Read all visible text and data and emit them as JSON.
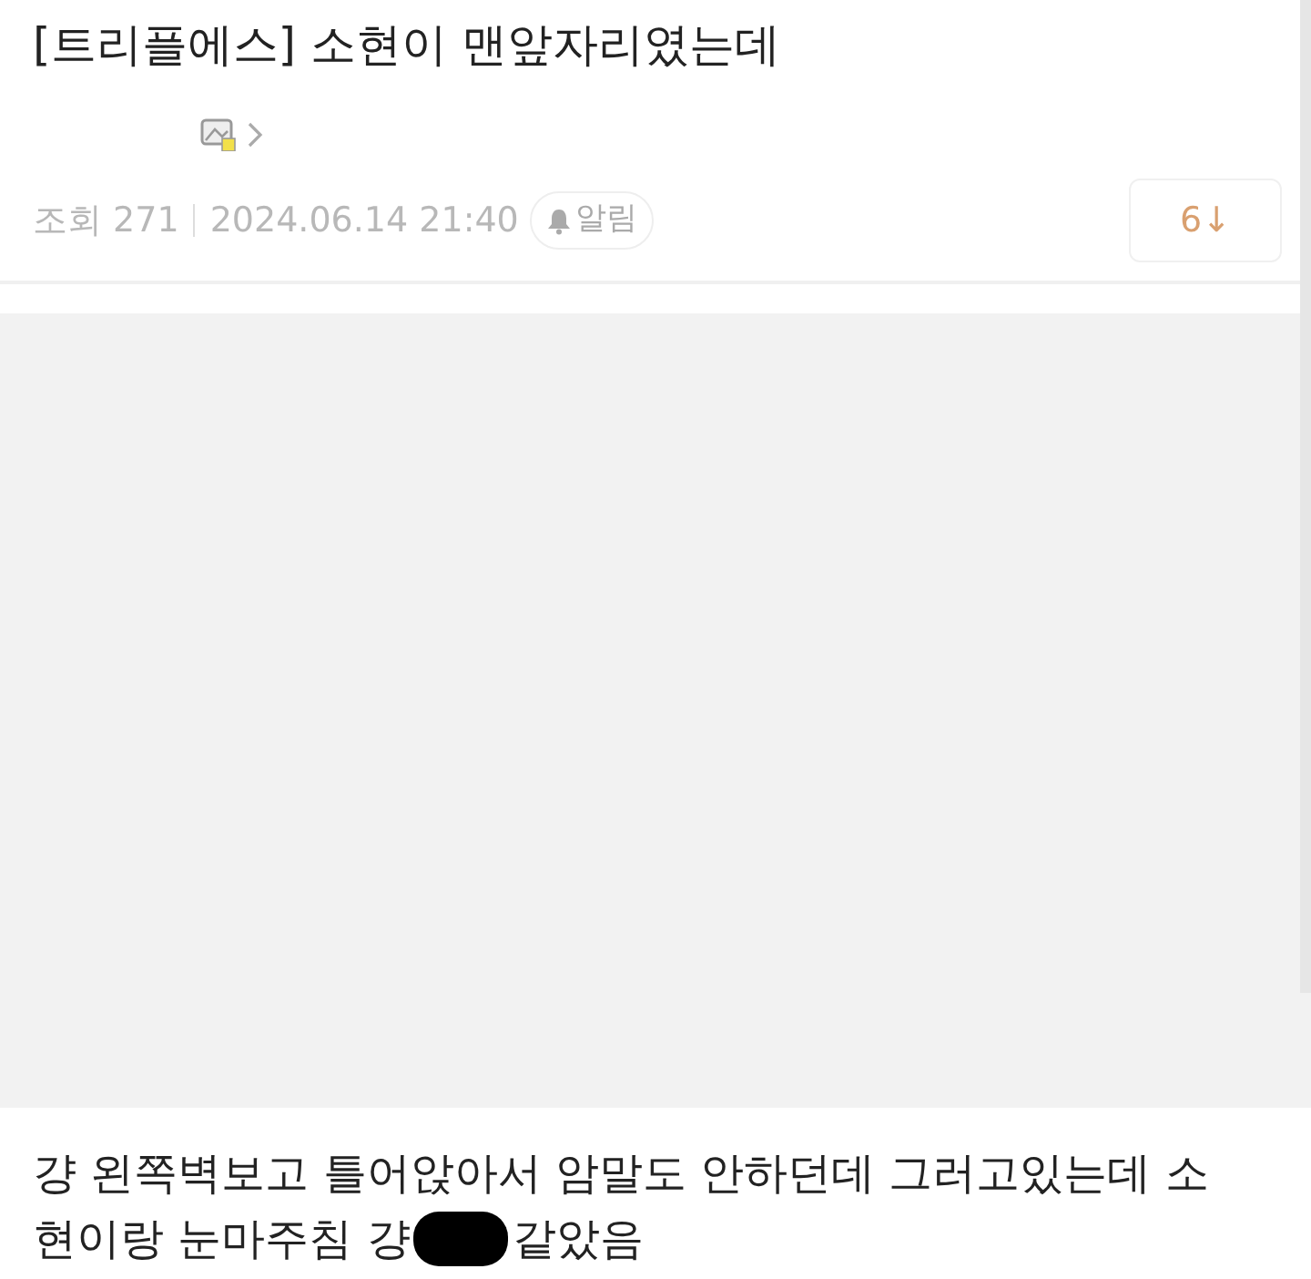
{
  "post": {
    "title": "[트리플에스] 소현이 맨앞자리였는데",
    "views": "조회 271",
    "date": "2024.06.14 21:40",
    "alert": "알림",
    "comment_count": "6↓"
  },
  "body": {
    "line_1": "걍 왼쪽벽보고 틀어앉아서 암말도 안하던데 그러고있는데 소",
    "line_2_before": "현이랑 눈마주침 걍",
    "line_2_after": "같았음"
  }
}
